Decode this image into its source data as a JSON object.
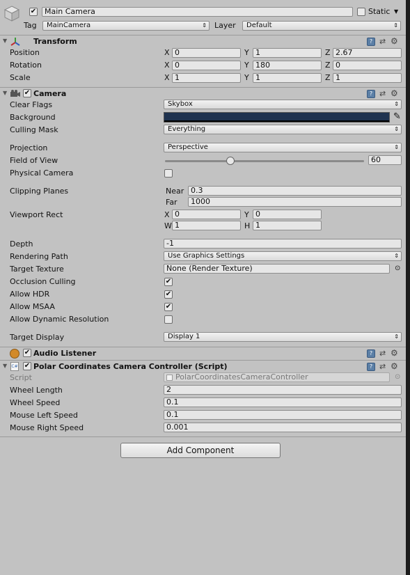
{
  "header": {
    "object_name": "Main Camera",
    "static_label": "Static",
    "tag_label": "Tag",
    "tag_value": "MainCamera",
    "layer_label": "Layer",
    "layer_value": "Default"
  },
  "transform": {
    "title": "Transform",
    "position": {
      "label": "Position",
      "x": "0",
      "y": "1",
      "z": "2.67"
    },
    "rotation": {
      "label": "Rotation",
      "x": "0",
      "y": "180",
      "z": "0"
    },
    "scale": {
      "label": "Scale",
      "x": "1",
      "y": "1",
      "z": "1"
    },
    "axis_x": "X",
    "axis_y": "Y",
    "axis_z": "Z"
  },
  "camera": {
    "title": "Camera",
    "clear_flags_label": "Clear Flags",
    "clear_flags": "Skybox",
    "background_label": "Background",
    "background_color": "#1f3350",
    "culling_mask_label": "Culling Mask",
    "culling_mask": "Everything",
    "projection_label": "Projection",
    "projection": "Perspective",
    "fov_label": "Field of View",
    "fov_value": "60",
    "fov_fraction": 0.33,
    "physical_label": "Physical Camera",
    "clipping_label": "Clipping Planes",
    "near_label": "Near",
    "near_value": "0.3",
    "far_label": "Far",
    "far_value": "1000",
    "viewport_label": "Viewport Rect",
    "vp_x_label": "X",
    "vp_x": "0",
    "vp_y_label": "Y",
    "vp_y": "0",
    "vp_w_label": "W",
    "vp_w": "1",
    "vp_h_label": "H",
    "vp_h": "1",
    "depth_label": "Depth",
    "depth_value": "-1",
    "rendering_path_label": "Rendering Path",
    "rendering_path": "Use Graphics Settings",
    "target_texture_label": "Target Texture",
    "target_texture": "None (Render Texture)",
    "occlusion_label": "Occlusion Culling",
    "hdr_label": "Allow HDR",
    "msaa_label": "Allow MSAA",
    "dynres_label": "Allow Dynamic Resolution",
    "target_display_label": "Target Display",
    "target_display": "Display 1"
  },
  "audio_listener": {
    "title": "Audio Listener"
  },
  "script": {
    "title": "Polar Coordinates Camera Controller (Script)",
    "script_label": "Script",
    "script_value": "PolarCoordinatesCameraController",
    "wheel_length_label": "Wheel Length",
    "wheel_length": "2",
    "wheel_speed_label": "Wheel Speed",
    "wheel_speed": "0.1",
    "mouse_left_label": "Mouse Left Speed",
    "mouse_left": "0.1",
    "mouse_right_label": "Mouse Right Speed",
    "mouse_right": "0.001"
  },
  "add_component_label": "Add Component",
  "icons": {
    "check": "✔",
    "arrow": "⇕",
    "object_picker": "⊙",
    "gear": "⚙",
    "fold": "▼",
    "eyedropper": "✎"
  }
}
